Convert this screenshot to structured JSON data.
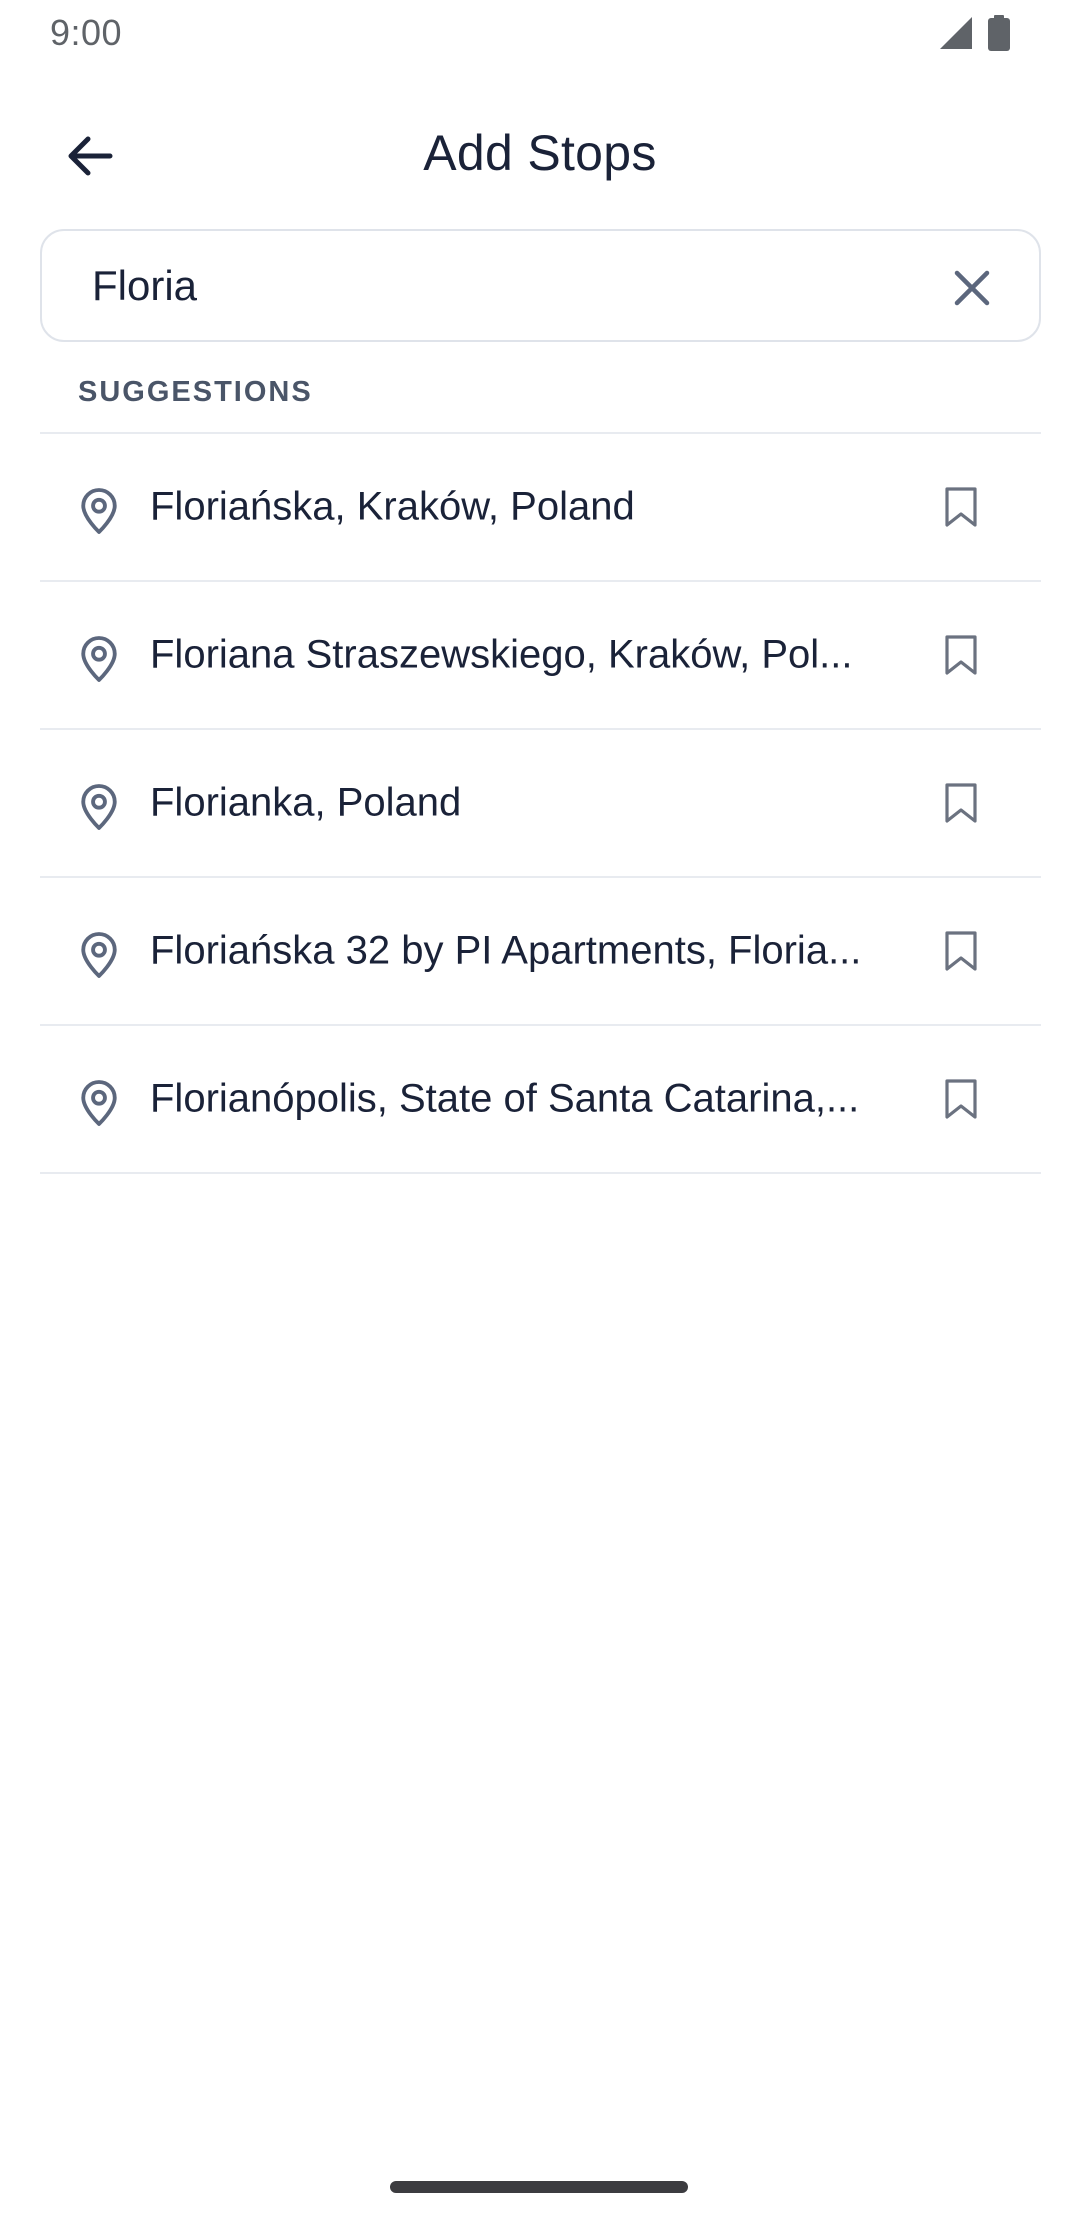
{
  "status_bar": {
    "time": "9:00",
    "icons": [
      "signal-icon",
      "battery-icon"
    ]
  },
  "header": {
    "back_icon": "arrow-left-icon",
    "title": "Add Stops"
  },
  "search": {
    "value": "Floria",
    "clear_icon": "close-icon"
  },
  "suggestions": {
    "header": "SUGGESTIONS",
    "items": [
      {
        "label": "Floriańska, Kraków, Poland",
        "icon": "map-pin-icon",
        "action_icon": "bookmark-icon"
      },
      {
        "label": "Floriana Straszewskiego, Kraków, Pol...",
        "icon": "map-pin-icon",
        "action_icon": "bookmark-icon"
      },
      {
        "label": "Florianka, Poland",
        "icon": "map-pin-icon",
        "action_icon": "bookmark-icon"
      },
      {
        "label": "Floriańska 32 by PI Apartments, Floria...",
        "icon": "map-pin-icon",
        "action_icon": "bookmark-icon"
      },
      {
        "label": "Florianópolis, State of Santa Catarina,...",
        "icon": "map-pin-icon",
        "action_icon": "bookmark-icon"
      }
    ]
  },
  "colors": {
    "text_primary": "#1a2238",
    "text_secondary": "#4a5568",
    "icon_gray": "#5c677d",
    "divider": "#e8ebf0",
    "border": "#dfe3ea"
  }
}
